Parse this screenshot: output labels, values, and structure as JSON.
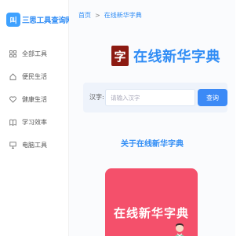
{
  "brand": {
    "logo_glyph": "叫",
    "name": "三思工具查询网"
  },
  "sidebar": {
    "items": [
      {
        "label": "全部工具",
        "icon": "grid-icon"
      },
      {
        "label": "便民生活",
        "icon": "home-icon"
      },
      {
        "label": "健康生活",
        "icon": "heart-icon"
      },
      {
        "label": "学习效率",
        "icon": "book-icon"
      },
      {
        "label": "电脑工具",
        "icon": "monitor-icon"
      }
    ]
  },
  "breadcrumb": {
    "home": "首页",
    "separator": ">",
    "current": "在线新华字典"
  },
  "hero": {
    "logo_glyph": "字",
    "title": "在线新华字典"
  },
  "search": {
    "label": "汉字:",
    "placeholder": "请输入汉字",
    "button": "查询"
  },
  "section": {
    "title": "关于在线新华字典"
  },
  "banner": {
    "text": "在线新华字典"
  },
  "colors": {
    "accent": "#2f8cf5",
    "button": "#3c8af6",
    "banner": "#f4506b",
    "logo_dark_red": "#8c1a12"
  }
}
